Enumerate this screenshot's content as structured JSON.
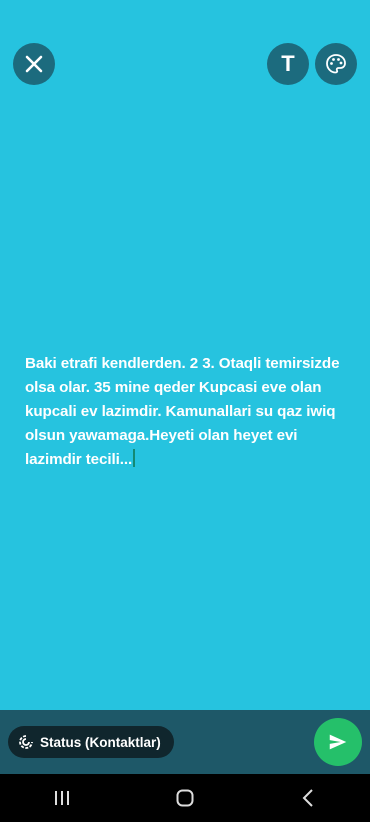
{
  "composer": {
    "background_color": "#26c3df",
    "status_text": "Baki etrafi kendlerden. 2   3. Otaqli temirsizde olsa olar. 35 mine qeder Kupcasi eve olan kupcali ev lazimdir. Kamunallari su qaz iwiq olsun yawamaga.Heyeti olan heyet evi lazimdir tecili..."
  },
  "toolbar": {
    "close_icon": "close-icon",
    "text_tool_label": "T",
    "palette_icon": "palette-icon"
  },
  "footer": {
    "audience_label": "Status (Kontaktlar)",
    "audience_icon": "status-icon",
    "send_icon": "send-icon",
    "send_color": "#25c06a"
  },
  "navigation": {
    "recents_icon": "recents-icon",
    "home_icon": "home-icon",
    "back_icon": "back-icon"
  }
}
